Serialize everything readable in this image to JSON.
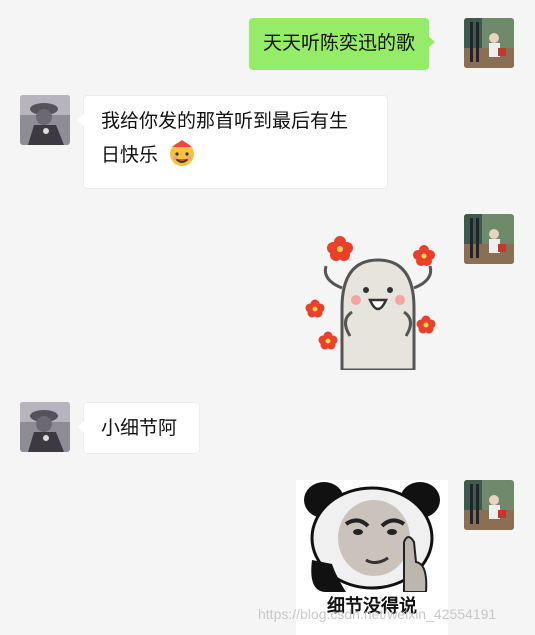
{
  "messages": [
    {
      "sender": "me",
      "type": "text",
      "text": "天天听陈奕迅的歌"
    },
    {
      "sender": "them",
      "type": "text",
      "line1": "我给你发的那首听到最后有生",
      "line2": "日快乐",
      "emoji": "birthday-face-emoji"
    },
    {
      "sender": "me",
      "type": "sticker",
      "sticker": "happy-cartoon-with-flowers"
    },
    {
      "sender": "them",
      "type": "text",
      "text": "小细节阿"
    },
    {
      "sender": "me",
      "type": "sticker",
      "sticker": "panda-meme",
      "caption": "细节没得说"
    }
  ],
  "watermark": "https://blog.csdn.net/weixin_42554191",
  "colors": {
    "background": "#f5f5f5",
    "my_bubble": "#95ec69",
    "their_bubble": "#ffffff"
  }
}
